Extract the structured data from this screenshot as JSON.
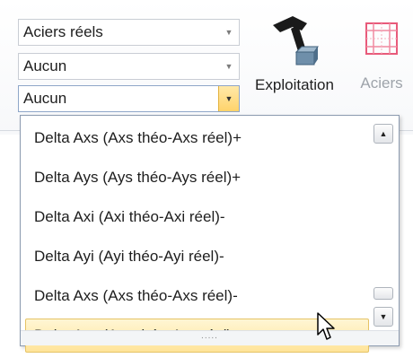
{
  "ribbon": {
    "combo1": {
      "value": "Aciers réels"
    },
    "combo2": {
      "value": "Aucun"
    },
    "combo3": {
      "value": "Aucun"
    },
    "exploitation_label": "Exploitation",
    "aciers_label": "Aciers"
  },
  "dropdown": {
    "items": [
      "Delta Axs (Axs théo-Axs réel)+",
      "Delta Ays (Ays théo-Ays réel)+",
      "Delta Axi (Axi théo-Axi réel)-",
      "Delta Ayi (Ayi théo-Ayi réel)-",
      "Delta Axs (Axs théo-Axs réel)-",
      "Delta Ays (Ays théo-Ays réel)-"
    ],
    "hovered_item": "Delta Ays (Ays théo-Ays réel)-",
    "scroll_up_glyph": "▲",
    "scroll_down_glyph": "▼",
    "grip_glyph": "....."
  },
  "colors": {
    "hover_bg": "#ffe49a",
    "hover_border": "#e5c365",
    "aciers_icon": "#e85a7a"
  }
}
